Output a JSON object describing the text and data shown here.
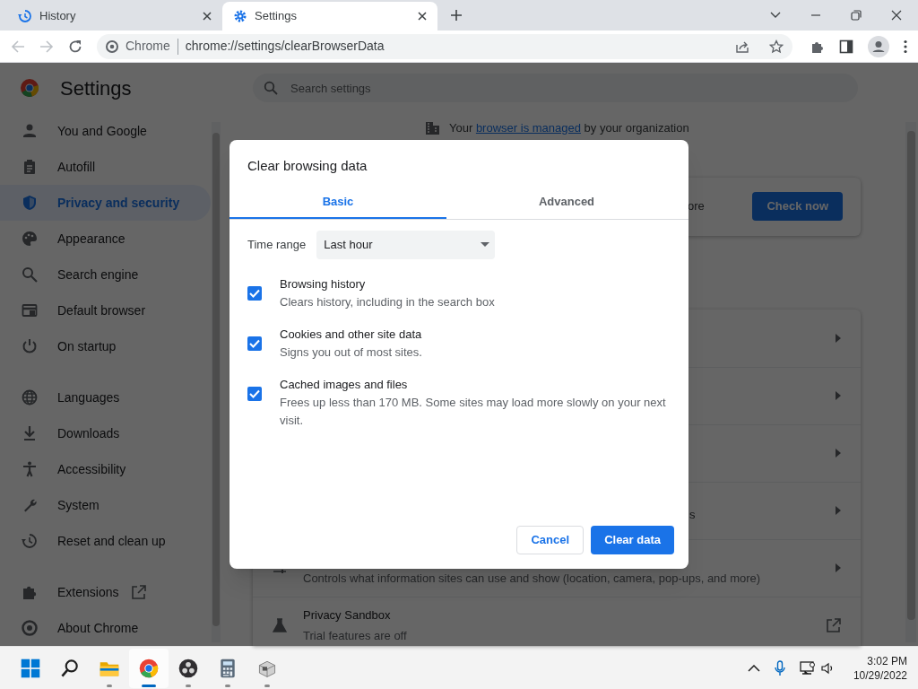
{
  "browser_tabs": [
    {
      "title": "History",
      "kind": "history",
      "selected": false
    },
    {
      "title": "Settings",
      "kind": "settings",
      "selected": true
    }
  ],
  "address_bar": {
    "site_label": "Chrome",
    "url": "chrome://settings/clearBrowserData"
  },
  "settings": {
    "title": "Settings",
    "nav_groups": [
      [
        {
          "label": "You and Google",
          "selected": false,
          "external_link": false
        },
        {
          "label": "Autofill",
          "selected": false,
          "external_link": false
        },
        {
          "label": "Privacy and security",
          "selected": true,
          "external_link": false
        },
        {
          "label": "Appearance",
          "selected": false,
          "external_link": false
        },
        {
          "label": "Search engine",
          "selected": false,
          "external_link": false
        },
        {
          "label": "Default browser",
          "selected": false,
          "external_link": false
        },
        {
          "label": "On startup",
          "selected": false,
          "external_link": false
        }
      ],
      [
        {
          "label": "Languages",
          "selected": false,
          "external_link": false
        },
        {
          "label": "Downloads",
          "selected": false,
          "external_link": false
        },
        {
          "label": "Accessibility",
          "selected": false,
          "external_link": false
        },
        {
          "label": "System",
          "selected": false,
          "external_link": false
        },
        {
          "label": "Reset and clean up",
          "selected": false,
          "external_link": false
        }
      ],
      [
        {
          "label": "Extensions",
          "selected": false,
          "external_link": true
        },
        {
          "label": "About Chrome",
          "selected": false,
          "external_link": false
        }
      ]
    ],
    "search_placeholder": "Search settings",
    "managed_notice": {
      "before": "Your",
      "link": "browser is managed",
      "after": "by your organization"
    },
    "safety_card": {
      "text_fragment": "ore",
      "button": "Check now"
    },
    "privacy_rows": [
      {
        "kind": "arrow"
      },
      {
        "kind": "arrow"
      },
      {
        "kind": "arrow"
      },
      {
        "kind": "arrow",
        "text_fragment": "s"
      },
      {
        "kind": "arrow",
        "subtitle": "Controls what information sites can use and show (location, camera, pop-ups, and more)"
      },
      {
        "kind": "external",
        "title": "Privacy Sandbox",
        "subtitle": "Trial features are off"
      }
    ]
  },
  "dialog": {
    "title": "Clear browsing data",
    "tabs": [
      {
        "label": "Basic",
        "selected": true
      },
      {
        "label": "Advanced",
        "selected": false
      }
    ],
    "time_range": {
      "label": "Time range",
      "value": "Last hour"
    },
    "items": [
      {
        "title": "Browsing history",
        "description": "Clears history, including in the search box",
        "checked": true
      },
      {
        "title": "Cookies and other site data",
        "description": "Signs you out of most sites.",
        "checked": true
      },
      {
        "title": "Cached images and files",
        "description": "Frees up less than 170 MB. Some sites may load more slowly on your next visit.",
        "checked": true
      }
    ],
    "buttons": [
      {
        "label": "Cancel",
        "kind": "secondary"
      },
      {
        "label": "Clear data",
        "kind": "primary"
      }
    ]
  },
  "taskbar": {
    "apps": [
      {
        "kind": "start",
        "running": false,
        "active": false
      },
      {
        "kind": "search",
        "running": false,
        "active": false
      },
      {
        "kind": "folder",
        "running": true,
        "active": false
      },
      {
        "kind": "chrome",
        "running": true,
        "active": true
      },
      {
        "kind": "obs",
        "running": true,
        "active": false
      },
      {
        "kind": "calculator",
        "running": true,
        "active": false
      },
      {
        "kind": "app",
        "running": true,
        "active": false
      }
    ],
    "time": "3:02 PM",
    "date": "10/29/2022"
  }
}
